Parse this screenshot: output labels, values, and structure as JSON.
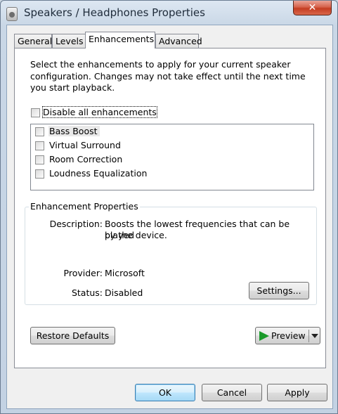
{
  "window": {
    "title": "Speakers / Headphones Properties",
    "close_symbol": "✕"
  },
  "tabs": [
    {
      "label": "General",
      "active": false
    },
    {
      "label": "Levels",
      "active": false
    },
    {
      "label": "Enhancements",
      "active": true
    },
    {
      "label": "Advanced",
      "active": false
    }
  ],
  "enhancements": {
    "intro": "Select the enhancements to apply for your current speaker configuration. Changes may not take effect until the next time you start playback.",
    "disable_all_label": "Disable all enhancements",
    "disable_all_checked": false,
    "items": [
      {
        "label": "Bass Boost",
        "checked": false,
        "selected": true
      },
      {
        "label": "Virtual Surround",
        "checked": false,
        "selected": false
      },
      {
        "label": "Room Correction",
        "checked": false,
        "selected": false
      },
      {
        "label": "Loudness Equalization",
        "checked": false,
        "selected": false
      }
    ]
  },
  "properties": {
    "group_title": "Enhancement Properties",
    "description_label": "Description:",
    "description_line1": "Boosts the lowest frequencies that can be played",
    "description_line2": "by the device.",
    "provider_label": "Provider:",
    "provider_value": "Microsoft",
    "status_label": "Status:",
    "status_value": "Disabled",
    "settings_button": "Settings..."
  },
  "actions": {
    "restore_defaults": "Restore Defaults",
    "preview": "Preview"
  },
  "footer": {
    "ok": "OK",
    "cancel": "Cancel",
    "apply": "Apply"
  },
  "colors": {
    "close_button": "#c43d22",
    "default_button_border": "#3c7fb1",
    "preview_play_icon": "#1a9a2a"
  }
}
